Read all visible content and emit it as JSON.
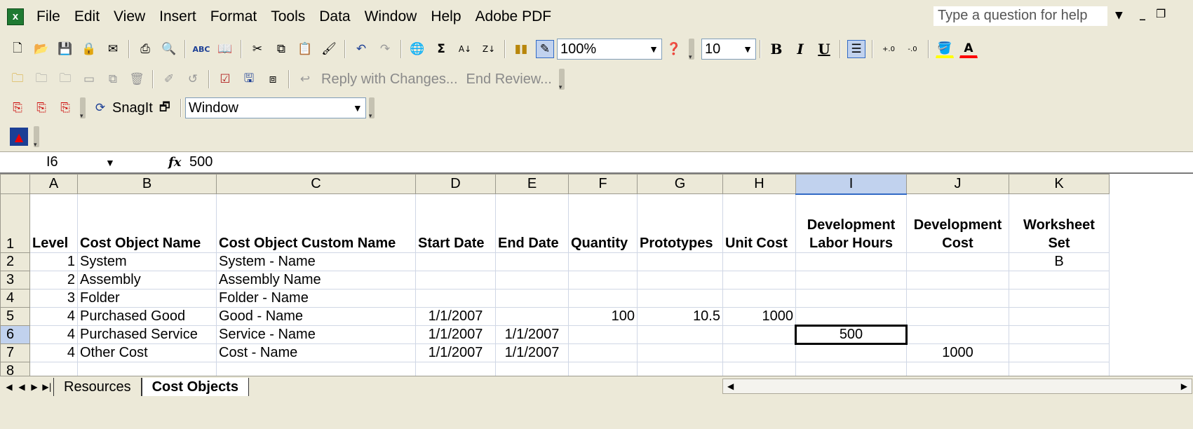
{
  "menu": [
    "File",
    "Edit",
    "View",
    "Insert",
    "Format",
    "Tools",
    "Data",
    "Window",
    "Help",
    "Adobe PDF"
  ],
  "help_placeholder": "Type a question for help",
  "toolbar1": {
    "zoom": "100%",
    "font_size": "10"
  },
  "toolbar2": {
    "reply_label": "Reply with Changes...",
    "end_review_label": "End Review..."
  },
  "toolbar3": {
    "snagit_label": "SnagIt",
    "capture_mode": "Window"
  },
  "formula_bar": {
    "name_box": "I6",
    "content": "500"
  },
  "columns": [
    "A",
    "B",
    "C",
    "D",
    "E",
    "F",
    "G",
    "H",
    "I",
    "J",
    "K"
  ],
  "selected_column": "I",
  "selected_row": 6,
  "header_row": {
    "row": "1",
    "cells": [
      "Level",
      "Cost Object Name",
      "Cost Object Custom Name",
      "Start Date",
      "End Date",
      "Quantity",
      "Prototypes",
      "Unit Cost",
      "Development Labor Hours",
      "Development Cost",
      "Worksheet Set"
    ]
  },
  "rows": [
    {
      "row": "2",
      "cells": [
        "1",
        "System",
        "System - Name",
        "",
        "",
        "",
        "",
        "",
        "",
        "",
        "B"
      ]
    },
    {
      "row": "3",
      "cells": [
        "2",
        "Assembly",
        "Assembly Name",
        "",
        "",
        "",
        "",
        "",
        "",
        "",
        ""
      ]
    },
    {
      "row": "4",
      "cells": [
        "3",
        "Folder",
        "Folder - Name",
        "",
        "",
        "",
        "",
        "",
        "",
        "",
        ""
      ]
    },
    {
      "row": "5",
      "cells": [
        "4",
        "Purchased Good",
        "Good - Name",
        "1/1/2007",
        "",
        "100",
        "10.5",
        "1000",
        "",
        "",
        ""
      ]
    },
    {
      "row": "6",
      "cells": [
        "4",
        "Purchased Service",
        "Service - Name",
        "1/1/2007",
        "1/1/2007",
        "",
        "",
        "",
        "500",
        "",
        ""
      ]
    },
    {
      "row": "7",
      "cells": [
        "4",
        "Other Cost",
        "Cost - Name",
        "1/1/2007",
        "1/1/2007",
        "",
        "",
        "",
        "",
        "1000",
        ""
      ]
    },
    {
      "row": "8",
      "cells": [
        "",
        "",
        "",
        "",
        "",
        "",
        "",
        "",
        "",
        "",
        ""
      ]
    }
  ],
  "sheet_tabs": [
    {
      "label": "Resources",
      "active": false
    },
    {
      "label": "Cost Objects",
      "active": true
    }
  ]
}
